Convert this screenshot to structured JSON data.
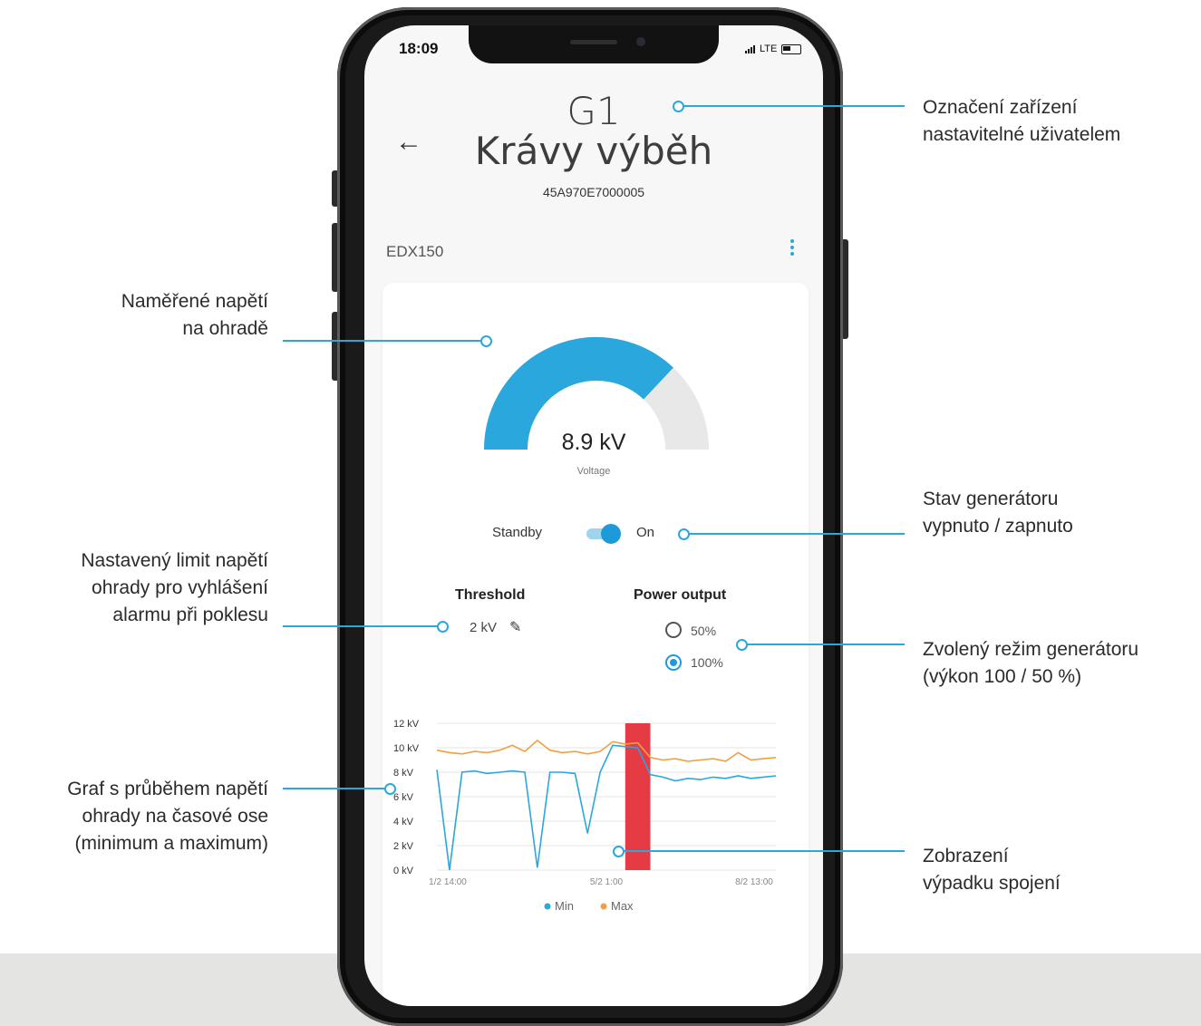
{
  "phone": {
    "status": {
      "time": "18:09",
      "network": "LTE"
    },
    "header": {
      "device_code": "G1",
      "device_name": "Krávy výběh",
      "serial": "45A970E7000005"
    },
    "model": "EDX150",
    "gauge": {
      "value": "8.9 kV",
      "label": "Voltage",
      "fill_fraction": 0.74,
      "fill_color": "#2aa7dd",
      "empty_color": "#e8e8e8"
    },
    "power_switch": {
      "off_label": "Standby",
      "on_label": "On",
      "state": "on"
    },
    "threshold": {
      "title": "Threshold",
      "value": "2 kV"
    },
    "power_output": {
      "title": "Power output",
      "options": [
        {
          "label": "50%",
          "selected": false
        },
        {
          "label": "100%",
          "selected": true
        }
      ]
    }
  },
  "chart_data": {
    "type": "line",
    "y_ticks": [
      "12 kV",
      "10 kV",
      "8 kV",
      "6 kV",
      "4 kV",
      "2 kV",
      "0 kV"
    ],
    "ylim": [
      0,
      12
    ],
    "x_ticks": [
      "1/2 14:00",
      "5/2 1:00",
      "8/2 13:00"
    ],
    "legend": [
      "Min",
      "Max"
    ],
    "grid": true,
    "outage_color": "#e63b45",
    "series": [
      {
        "name": "Min",
        "color": "#2aa7dd",
        "values": [
          8.2,
          0.0,
          8.0,
          8.1,
          7.9,
          8.0,
          8.1,
          8.0,
          0.2,
          8.0,
          8.0,
          7.9,
          3.0,
          8.0,
          10.2,
          10.1,
          10.0,
          7.8,
          7.6,
          7.3,
          7.5,
          7.4,
          7.6,
          7.5,
          7.7,
          7.5,
          7.6,
          7.7
        ]
      },
      {
        "name": "Max",
        "color": "#f0a040",
        "values": [
          9.8,
          9.6,
          9.5,
          9.7,
          9.6,
          9.8,
          10.2,
          9.7,
          10.6,
          9.8,
          9.6,
          9.7,
          9.5,
          9.7,
          10.5,
          10.3,
          10.4,
          9.2,
          9.0,
          9.1,
          8.9,
          9.0,
          9.1,
          8.9,
          9.6,
          9.0,
          9.1,
          9.2
        ]
      }
    ],
    "outage_index_range": [
      15,
      17
    ]
  },
  "annotations": {
    "device_label": [
      "Označení zařízení",
      "nastavitelné uživatelem"
    ],
    "measured_voltage": [
      "Naměřené napětí",
      "na ohradě"
    ],
    "generator_state": [
      "Stav generátoru",
      "vypnuto / zapnuto"
    ],
    "threshold_limit": [
      "Nastavený limit napětí",
      "ohrady pro vyhlášení",
      "alarmu při poklesu"
    ],
    "generator_mode": [
      "Zvolený režim generátoru",
      "(výkon 100 / 50 %)"
    ],
    "voltage_graph": [
      "Graf s průběhem napětí",
      "ohrady na časové ose",
      "(minimum a maximum)"
    ],
    "connection_loss": [
      "Zobrazení",
      "výpadku spojení"
    ]
  }
}
